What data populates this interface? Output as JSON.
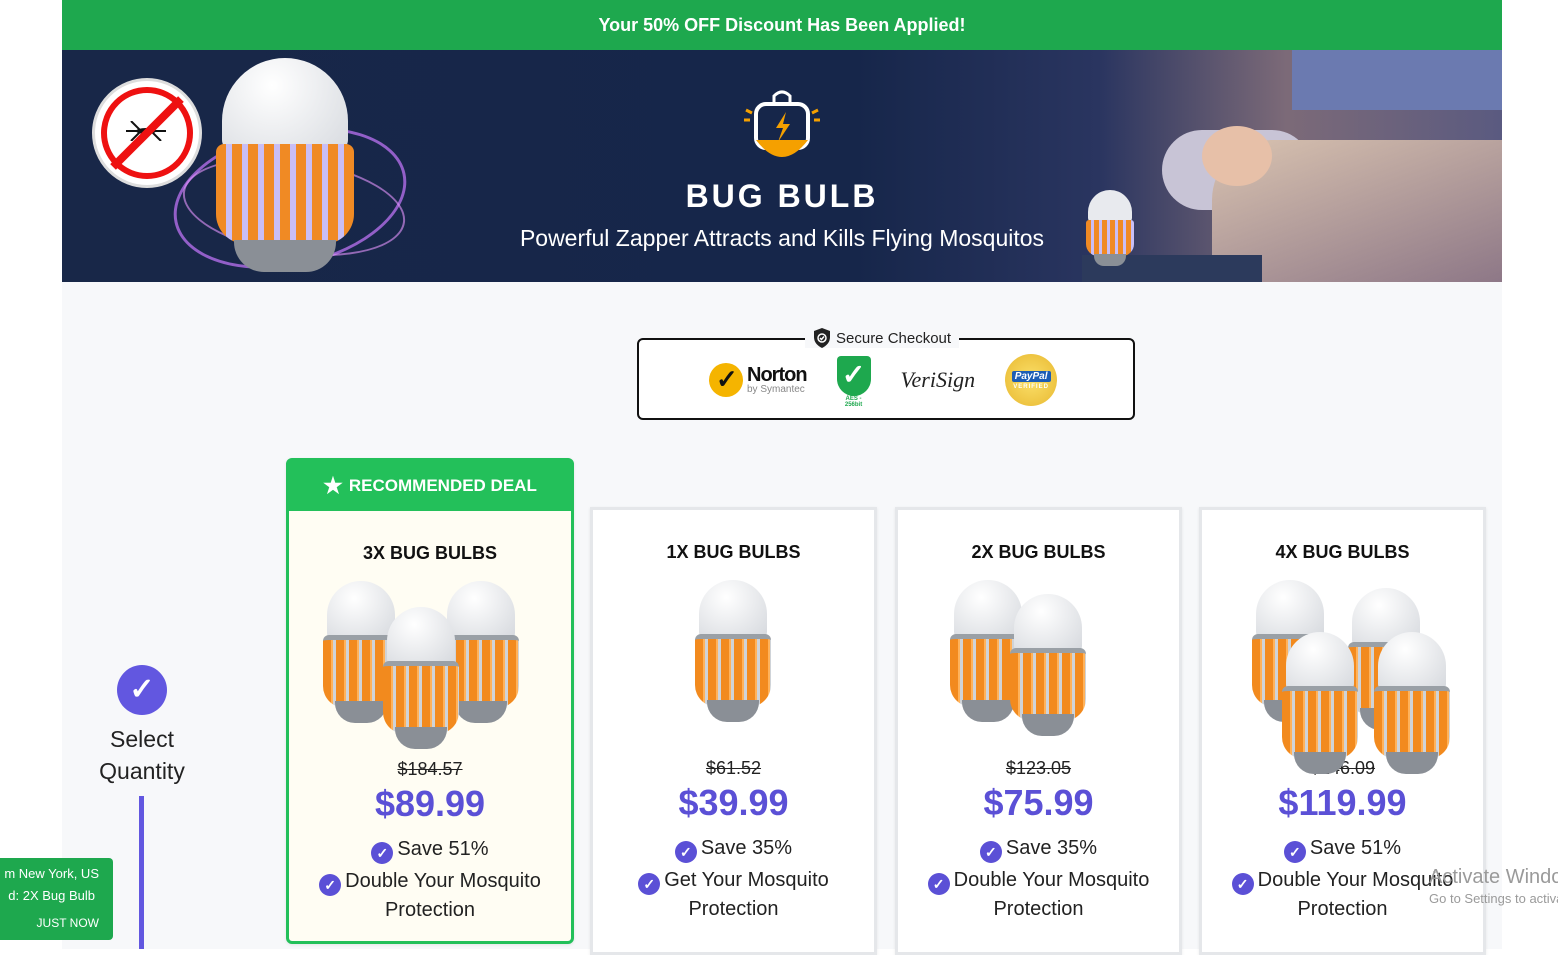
{
  "banner": {
    "text": "Your 50% OFF Discount Has Been Applied!"
  },
  "hero": {
    "brand": "BUG BULB",
    "tagline": "Powerful Zapper Attracts and Kills Flying Mosquitos",
    "icons": [
      "no-mosquito-icon",
      "bulb-logo-icon"
    ]
  },
  "secure": {
    "title": "Secure Checkout",
    "norton": "Norton",
    "norton_sub": "by Symantec",
    "aes": "AES - 256bit",
    "verisign": "VeriSign",
    "paypal": "PayPal",
    "paypal_sub": "VERIFIED"
  },
  "step": {
    "label_line1": "Select",
    "label_line2": "Quantity"
  },
  "recommended_label": "RECOMMENDED DEAL",
  "products": [
    {
      "title": "3X BUG BULBS",
      "old_price": "$184.57",
      "price": "$89.99",
      "save": "Save 51%",
      "perk": "Double Your Mosquito Protection",
      "qty": 3,
      "recommended": true
    },
    {
      "title": "1X BUG BULBS",
      "old_price": "$61.52",
      "price": "$39.99",
      "save": "Save 35%",
      "perk": "Get Your Mosquito Protection",
      "qty": 1,
      "recommended": false
    },
    {
      "title": "2X BUG BULBS",
      "old_price": "$123.05",
      "price": "$75.99",
      "save": "Save 35%",
      "perk": "Double Your Mosquito Protection",
      "qty": 2,
      "recommended": false
    },
    {
      "title": "4X BUG BULBS",
      "old_price": "$246.09",
      "price": "$119.99",
      "save": "Save 51%",
      "perk": "Double Your Mosquito Protection",
      "qty": 4,
      "recommended": false
    }
  ],
  "toast": {
    "line1": "m New York, US",
    "line2": "d: 2X Bug Bulb",
    "line3": "JUST NOW"
  },
  "watermark": {
    "line1": "Activate Windows",
    "line2": "Go to Settings to activate Windows."
  },
  "colors": {
    "green": "#1ea84e",
    "accent": "#5b50d6",
    "orange": "#f28a1e"
  }
}
